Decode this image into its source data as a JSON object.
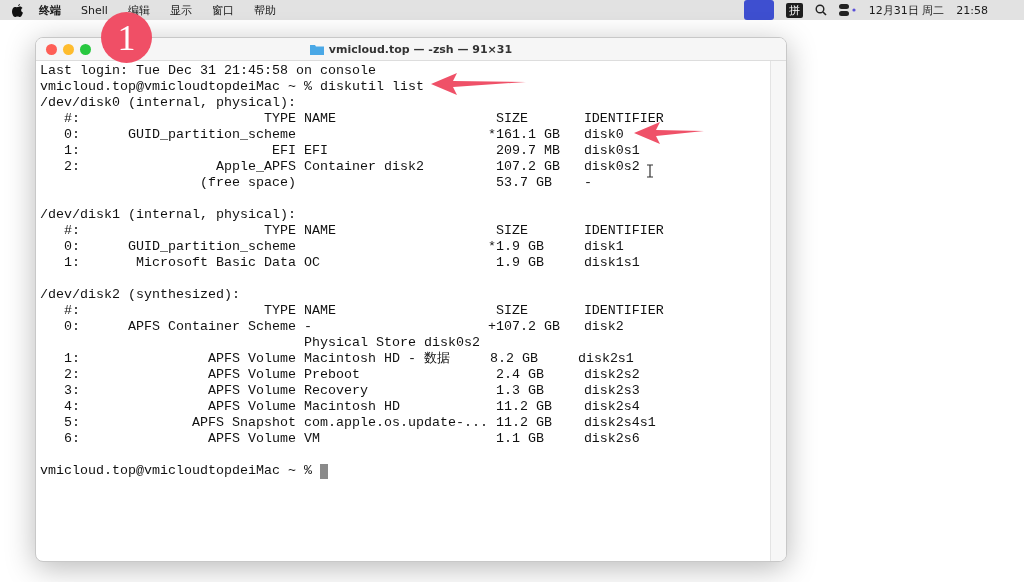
{
  "menubar": {
    "items": [
      {
        "label": "终端",
        "bold": true
      },
      {
        "label": "Shell",
        "bold": false
      },
      {
        "label": "编辑",
        "bold": false
      },
      {
        "label": "显示",
        "bold": false
      },
      {
        "label": "窗口",
        "bold": false
      },
      {
        "label": "帮助",
        "bold": false
      }
    ],
    "input_method": "拼",
    "date": "12月31日 周二",
    "time": "21:58"
  },
  "window": {
    "title": "vmicloud.top — -zsh — 91×31",
    "blocks": [
      {
        "lines": [
          "Last login: Tue Dec 31 21:45:58 on console",
          "vmicloud.top@vmicloudtopdeiMac ~ % diskutil list",
          "/dev/disk0 (internal, physical):",
          "   #:                       TYPE NAME                    SIZE       IDENTIFIER",
          "   0:      GUID_partition_scheme                        *161.1 GB   disk0",
          "   1:                        EFI EFI                     209.7 MB   disk0s1",
          "   2:                 Apple_APFS Container disk2         107.2 GB   disk0s2",
          "                    (free space)                         53.7 GB    -"
        ]
      },
      {
        "lines": [
          "/dev/disk1 (internal, physical):",
          "   #:                       TYPE NAME                    SIZE       IDENTIFIER",
          "   0:      GUID_partition_scheme                        *1.9 GB     disk1",
          "   1:       Microsoft Basic Data OC                      1.9 GB     disk1s1"
        ]
      },
      {
        "lines": [
          "/dev/disk2 (synthesized):",
          "   #:                       TYPE NAME                    SIZE       IDENTIFIER",
          "   0:      APFS Container Scheme -                      +107.2 GB   disk2",
          "                                 Physical Store disk0s2",
          "   1:                APFS Volume Macintosh HD - 数据     8.2 GB     disk2s1",
          "   2:                APFS Volume Preboot                 2.4 GB     disk2s2",
          "   3:                APFS Volume Recovery                1.3 GB     disk2s3",
          "   4:                APFS Volume Macintosh HD            11.2 GB    disk2s4",
          "   5:              APFS Snapshot com.apple.os.update-... 11.2 GB    disk2s4s1",
          "   6:                APFS Volume VM                      1.1 GB     disk2s6"
        ]
      }
    ],
    "prompt": "vmicloud.top@vmicloudtopdeiMac ~ %"
  },
  "annotation": {
    "badge": "1"
  }
}
